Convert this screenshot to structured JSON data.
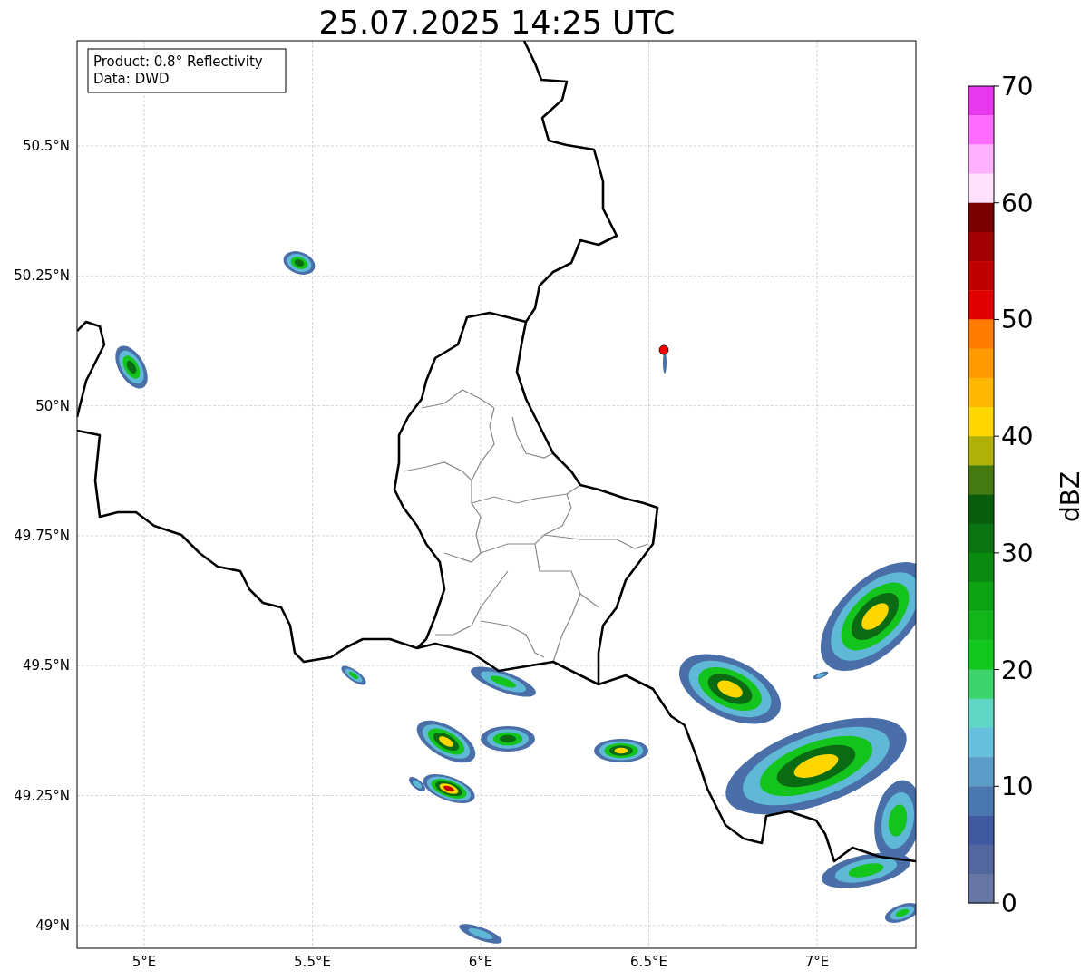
{
  "title": "25.07.2025 14:25 UTC",
  "info_box": [
    "Product: 0.8° Reflectivity",
    "Data: DWD"
  ],
  "x_ticks": [
    "5°E",
    "5.5°E",
    "6°E",
    "6.5°E",
    "7°E"
  ],
  "y_ticks": [
    "50.5°N",
    "50.25°N",
    "50°N",
    "49.75°N",
    "49.5°N",
    "49.25°N",
    "49°N"
  ],
  "colorbar": {
    "label": "dBZ",
    "ticks": [
      "70",
      "60",
      "50",
      "40",
      "30",
      "20",
      "10",
      "0"
    ],
    "bands": [
      {
        "color": "#e838ee"
      },
      {
        "color": "#ff6cff"
      },
      {
        "color": "#ffb0ff"
      },
      {
        "color": "#ffe0ff"
      },
      {
        "color": "#7a0000"
      },
      {
        "color": "#a00000"
      },
      {
        "color": "#c00000"
      },
      {
        "color": "#e00000"
      },
      {
        "color": "#ff7c00"
      },
      {
        "color": "#ff9a00"
      },
      {
        "color": "#ffb700"
      },
      {
        "color": "#ffd700"
      },
      {
        "color": "#b0b006"
      },
      {
        "color": "#457a10"
      },
      {
        "color": "#075d0c"
      },
      {
        "color": "#0a7410"
      },
      {
        "color": "#0b8a12"
      },
      {
        "color": "#0ea315"
      },
      {
        "color": "#10b61a"
      },
      {
        "color": "#12c81c"
      },
      {
        "color": "#3dd46d"
      },
      {
        "color": "#5fd6c6"
      },
      {
        "color": "#66bfdc"
      },
      {
        "color": "#5b9cc8"
      },
      {
        "color": "#4a78b0"
      },
      {
        "color": "#3f5aa0"
      },
      {
        "color": "#52679e"
      },
      {
        "color": "#6677a5"
      }
    ]
  }
}
